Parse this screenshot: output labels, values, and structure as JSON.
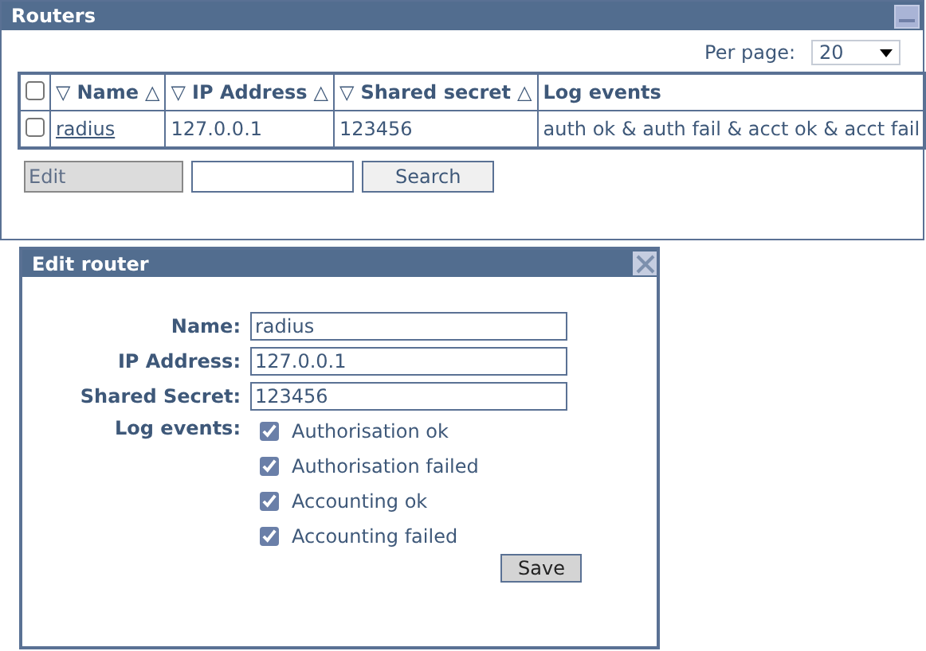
{
  "routers_panel": {
    "title": "Routers",
    "per_page": {
      "label": "Per page:",
      "value": "20"
    },
    "table": {
      "select_all": {
        "checked": false
      },
      "columns": [
        {
          "label": "Name",
          "sort_down": "▽",
          "sort_up": "△"
        },
        {
          "label": "IP Address",
          "sort_down": "▽",
          "sort_up": "△"
        },
        {
          "label": "Shared secret",
          "sort_down": "▽",
          "sort_up": "△"
        },
        {
          "label": "Log events"
        }
      ],
      "rows": [
        {
          "checked": false,
          "cells": [
            "radius",
            "127.0.0.1",
            "123456",
            "auth ok & auth fail & acct ok & acct fail"
          ]
        }
      ]
    },
    "edit_button": {
      "label": "Edit",
      "disabled": true
    },
    "search_button": {
      "label": "Search"
    }
  },
  "edit_dialog": {
    "title": "Edit router",
    "fields": [
      {
        "label": "Name:",
        "value": "radius"
      },
      {
        "label": "IP Address:",
        "value": "127.0.0.1"
      },
      {
        "label": "Shared Secret:",
        "value": "123456"
      }
    ],
    "log_events": {
      "label": "Log events:",
      "options": [
        {
          "label": "Authorisation ok",
          "checked": true
        },
        {
          "label": "Authorisation failed",
          "checked": true
        },
        {
          "label": "Accounting ok",
          "checked": true
        },
        {
          "label": "Accounting failed",
          "checked": true
        }
      ]
    },
    "save_button": {
      "label": "Save"
    }
  }
}
